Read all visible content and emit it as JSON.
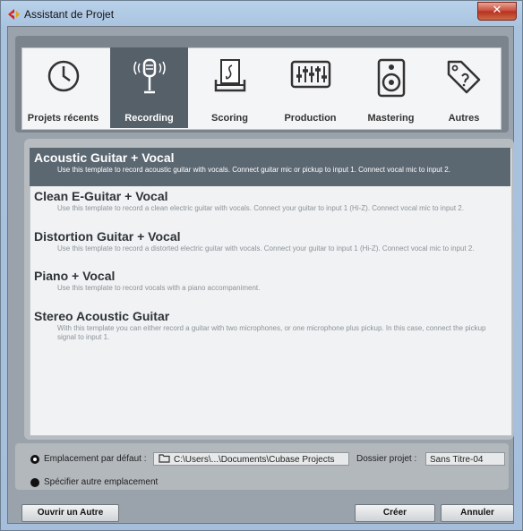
{
  "window": {
    "title": "Assistant de Projet",
    "close_glyph": "✕"
  },
  "categories": [
    {
      "label": "Projets récents",
      "icon": "clock-icon",
      "active": false
    },
    {
      "label": "Recording",
      "icon": "microphone-icon",
      "active": true
    },
    {
      "label": "Scoring",
      "icon": "sheet-music-icon",
      "active": false
    },
    {
      "label": "Production",
      "icon": "mixer-icon",
      "active": false
    },
    {
      "label": "Mastering",
      "icon": "speaker-icon",
      "active": false
    },
    {
      "label": "Autres",
      "icon": "tag-icon",
      "active": false
    }
  ],
  "templates": [
    {
      "title": "Acoustic Guitar + Vocal",
      "desc": "Use this template to record acoustic guitar with vocals. Connect guitar mic or pickup to input  1. Connect vocal mic to input 2.",
      "selected": true
    },
    {
      "title": "Clean E-Guitar + Vocal",
      "desc": "Use this template to record a clean electric guitar with vocals. Connect your guitar to input  1 (Hi-Z). Connect vocal mic to input 2.",
      "selected": false
    },
    {
      "title": "Distortion Guitar + Vocal",
      "desc": "Use this template to record a distorted electric guitar with vocals. Connect your guitar to input  1 (Hi-Z). Connect vocal mic to input 2.",
      "selected": false
    },
    {
      "title": "Piano + Vocal",
      "desc": "Use this template to record vocals with a piano accompaniment.",
      "selected": false
    },
    {
      "title": "Stereo Acoustic Guitar",
      "desc": "With this template you can either record a guitar with two microphones, or one microphone plus pickup. In this case, connect the pickup signal to input 1.",
      "selected": false
    }
  ],
  "location": {
    "default_label": "Emplacement par défaut :",
    "path": "C:\\Users\\...\\Documents\\Cubase Projects",
    "folder_label": "Dossier projet :",
    "folder_value": "Sans Titre-04",
    "other_label": "Spécifier autre emplacement"
  },
  "buttons": {
    "open_other": "Ouvrir un Autre",
    "create": "Créer",
    "cancel": "Annuler"
  },
  "colors": {
    "selected_row": "#5b6771",
    "active_category": "#566069"
  }
}
